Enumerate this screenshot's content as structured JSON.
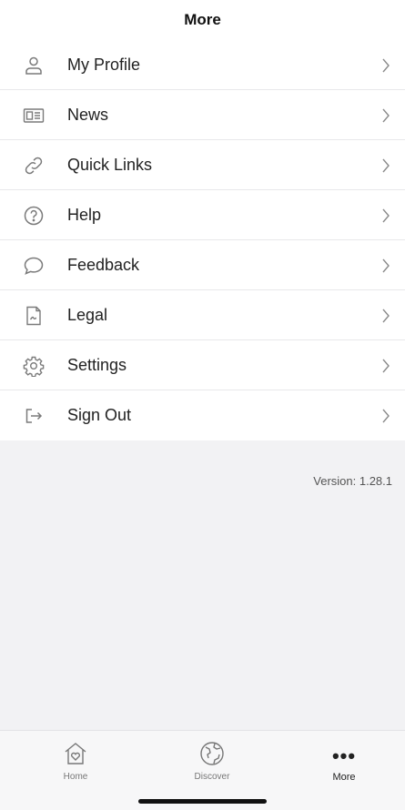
{
  "header": {
    "title": "More"
  },
  "menu": [
    {
      "label": "My Profile",
      "icon": "user-icon"
    },
    {
      "label": "News",
      "icon": "newspaper-icon"
    },
    {
      "label": "Quick Links",
      "icon": "link-icon"
    },
    {
      "label": "Help",
      "icon": "help-icon"
    },
    {
      "label": "Feedback",
      "icon": "chat-bubble-icon"
    },
    {
      "label": "Legal",
      "icon": "document-icon"
    },
    {
      "label": "Settings",
      "icon": "gear-icon"
    },
    {
      "label": "Sign Out",
      "icon": "sign-out-icon"
    }
  ],
  "version": "Version: 1.28.1",
  "tabbar": {
    "tabs": [
      {
        "label": "Home",
        "icon": "home-heart-icon"
      },
      {
        "label": "Discover",
        "icon": "globe-icon"
      },
      {
        "label": "More",
        "icon": "more-dots-icon",
        "active": true
      }
    ]
  },
  "colors": {
    "background": "#f2f2f4",
    "surface": "#ffffff",
    "text": "#222222",
    "icon": "#7a7a7a"
  }
}
